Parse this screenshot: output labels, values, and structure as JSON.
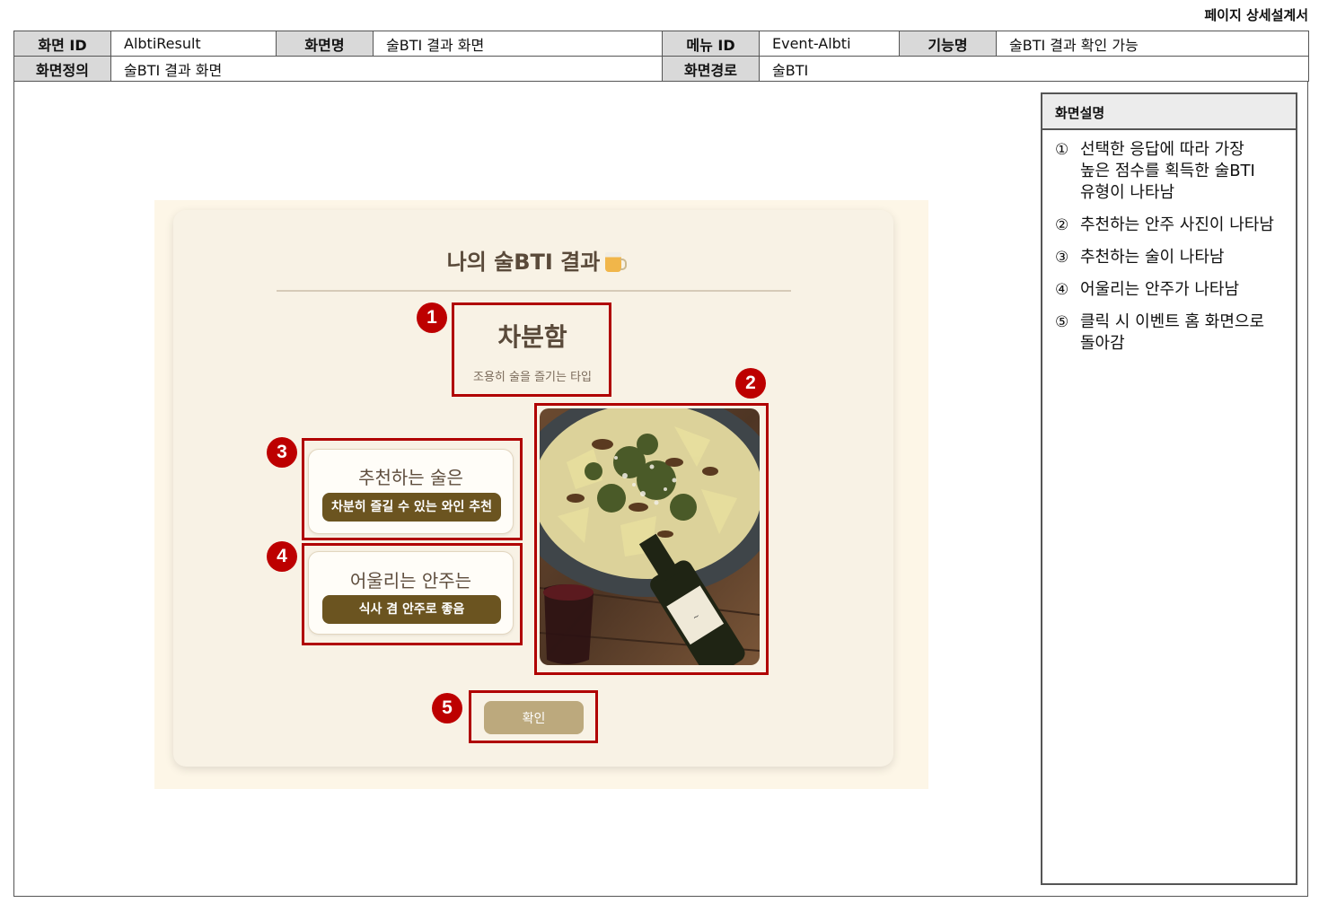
{
  "doc_title": "페이지 상세설계서",
  "meta": {
    "screen_id_label": "화면 ID",
    "screen_id": "AlbtiResult",
    "screen_name_label": "화면명",
    "screen_name": "술BTI 결과 화면",
    "menu_id_label": "메뉴 ID",
    "menu_id": "Event-Albti",
    "function_label": "기능명",
    "function_name": "술BTI 결과 확인 가능",
    "definition_label": "화면정의",
    "definition": "술BTI 결과 화면",
    "path_label": "화면경로",
    "path": "술BTI"
  },
  "description": {
    "title": "화면설명",
    "items": [
      {
        "num": "①",
        "text": "선택한 응답에 따라 가장\n높은 점수를 획득한 술BTI\n유형이 나타남"
      },
      {
        "num": "②",
        "text": "추천하는 안주 사진이 나타남"
      },
      {
        "num": "③",
        "text": "추천하는 술이 나타남"
      },
      {
        "num": "④",
        "text": "어울리는 안주가 나타남"
      },
      {
        "num": "⑤",
        "text": "클릭 시 이벤트 홈 화면으로\n돌아감"
      }
    ]
  },
  "mockup": {
    "title": "나의 술BTI 결과",
    "type_name": "차분함",
    "type_desc": "조용히 술을 즐기는 타입",
    "drink_label": "추천하는 술은",
    "drink_value": "차분히 즐길 수 있는 와인 추천",
    "snack_label": "어울리는 안주는",
    "snack_value": "식사 겸 안주로 좋음",
    "confirm_label": "확인"
  },
  "badges": [
    "1",
    "2",
    "3",
    "4",
    "5"
  ],
  "colors": {
    "highlight": "#b00000",
    "pill": "#6b5420",
    "confirm": "#bca97d",
    "card_bg": "#f8f2e5"
  }
}
